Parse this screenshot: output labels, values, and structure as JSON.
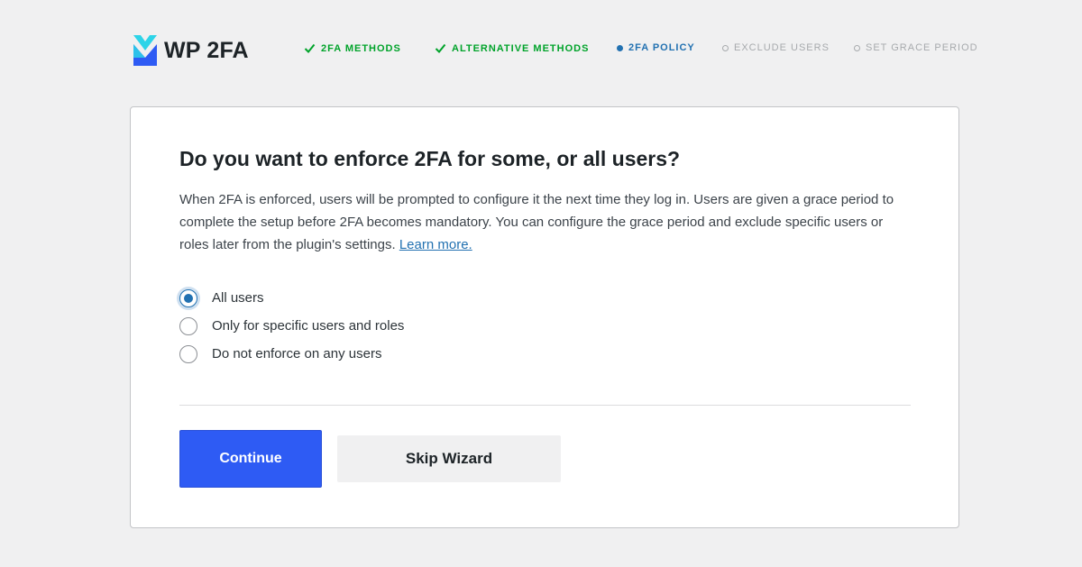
{
  "brand": {
    "name": "WP 2FA",
    "colors": {
      "logo_light": "#2dd4e8",
      "logo_dark": "#2e5bf4"
    }
  },
  "steps": [
    {
      "label": "2FA METHODS",
      "status": "done"
    },
    {
      "label": "ALTERNATIVE METHODS",
      "status": "done"
    },
    {
      "label": "2FA POLICY",
      "status": "current"
    },
    {
      "label": "EXCLUDE USERS",
      "status": "pending"
    },
    {
      "label": "SET GRACE PERIOD",
      "status": "pending"
    }
  ],
  "card": {
    "title": "Do you want to enforce 2FA for some, or all users?",
    "description": "When 2FA is enforced, users will be prompted to configure it the next time they log in. Users are given a grace period to complete the setup before 2FA becomes mandatory. You can configure the grace period and exclude specific users or roles later from the plugin's settings.",
    "learn_more": "Learn more.",
    "options": [
      {
        "label": "All users",
        "checked": true
      },
      {
        "label": "Only for specific users and roles",
        "checked": false
      },
      {
        "label": "Do not enforce on any users",
        "checked": false
      }
    ],
    "continue_label": "Continue",
    "skip_label": "Skip Wizard"
  },
  "colors": {
    "done": "#00a32a",
    "current": "#2271b1",
    "pending": "#a7aaad",
    "primary_button": "#2e5bf4"
  }
}
